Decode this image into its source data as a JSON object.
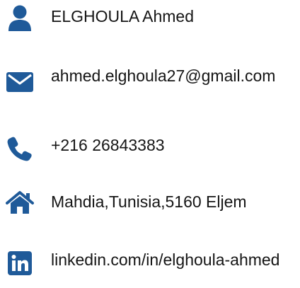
{
  "colors": {
    "icon": "#1f5a99",
    "text": "#151515",
    "background": "#ffffff"
  },
  "contacts": [
    {
      "icon": "user-icon",
      "text": "ELGHOULA Ahmed"
    },
    {
      "icon": "envelope-icon",
      "text": "ahmed.elghoula27@gmail.com"
    },
    {
      "icon": "phone-icon",
      "text": "+216 26843383"
    },
    {
      "icon": "home-icon",
      "text": "Mahdia,Tunisia,5160 Eljem"
    },
    {
      "icon": "linkedin-icon",
      "text": "linkedin.com/in/elghoula-ahmed"
    }
  ]
}
